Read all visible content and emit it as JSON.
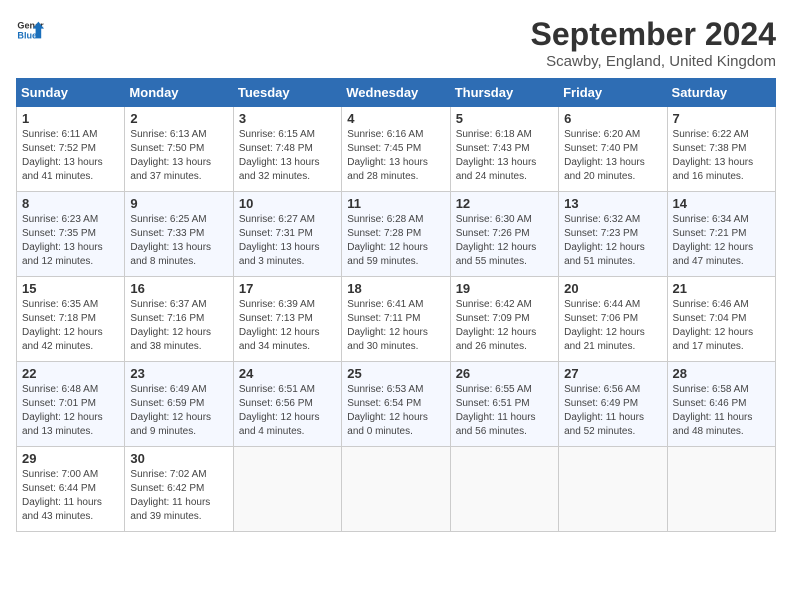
{
  "header": {
    "logo_line1": "General",
    "logo_line2": "Blue",
    "month": "September 2024",
    "location": "Scawby, England, United Kingdom"
  },
  "weekdays": [
    "Sunday",
    "Monday",
    "Tuesday",
    "Wednesday",
    "Thursday",
    "Friday",
    "Saturday"
  ],
  "weeks": [
    [
      {
        "day": "1",
        "sunrise": "6:11 AM",
        "sunset": "7:52 PM",
        "daylight": "13 hours and 41 minutes."
      },
      {
        "day": "2",
        "sunrise": "6:13 AM",
        "sunset": "7:50 PM",
        "daylight": "13 hours and 37 minutes."
      },
      {
        "day": "3",
        "sunrise": "6:15 AM",
        "sunset": "7:48 PM",
        "daylight": "13 hours and 32 minutes."
      },
      {
        "day": "4",
        "sunrise": "6:16 AM",
        "sunset": "7:45 PM",
        "daylight": "13 hours and 28 minutes."
      },
      {
        "day": "5",
        "sunrise": "6:18 AM",
        "sunset": "7:43 PM",
        "daylight": "13 hours and 24 minutes."
      },
      {
        "day": "6",
        "sunrise": "6:20 AM",
        "sunset": "7:40 PM",
        "daylight": "13 hours and 20 minutes."
      },
      {
        "day": "7",
        "sunrise": "6:22 AM",
        "sunset": "7:38 PM",
        "daylight": "13 hours and 16 minutes."
      }
    ],
    [
      {
        "day": "8",
        "sunrise": "6:23 AM",
        "sunset": "7:35 PM",
        "daylight": "13 hours and 12 minutes."
      },
      {
        "day": "9",
        "sunrise": "6:25 AM",
        "sunset": "7:33 PM",
        "daylight": "13 hours and 8 minutes."
      },
      {
        "day": "10",
        "sunrise": "6:27 AM",
        "sunset": "7:31 PM",
        "daylight": "13 hours and 3 minutes."
      },
      {
        "day": "11",
        "sunrise": "6:28 AM",
        "sunset": "7:28 PM",
        "daylight": "12 hours and 59 minutes."
      },
      {
        "day": "12",
        "sunrise": "6:30 AM",
        "sunset": "7:26 PM",
        "daylight": "12 hours and 55 minutes."
      },
      {
        "day": "13",
        "sunrise": "6:32 AM",
        "sunset": "7:23 PM",
        "daylight": "12 hours and 51 minutes."
      },
      {
        "day": "14",
        "sunrise": "6:34 AM",
        "sunset": "7:21 PM",
        "daylight": "12 hours and 47 minutes."
      }
    ],
    [
      {
        "day": "15",
        "sunrise": "6:35 AM",
        "sunset": "7:18 PM",
        "daylight": "12 hours and 42 minutes."
      },
      {
        "day": "16",
        "sunrise": "6:37 AM",
        "sunset": "7:16 PM",
        "daylight": "12 hours and 38 minutes."
      },
      {
        "day": "17",
        "sunrise": "6:39 AM",
        "sunset": "7:13 PM",
        "daylight": "12 hours and 34 minutes."
      },
      {
        "day": "18",
        "sunrise": "6:41 AM",
        "sunset": "7:11 PM",
        "daylight": "12 hours and 30 minutes."
      },
      {
        "day": "19",
        "sunrise": "6:42 AM",
        "sunset": "7:09 PM",
        "daylight": "12 hours and 26 minutes."
      },
      {
        "day": "20",
        "sunrise": "6:44 AM",
        "sunset": "7:06 PM",
        "daylight": "12 hours and 21 minutes."
      },
      {
        "day": "21",
        "sunrise": "6:46 AM",
        "sunset": "7:04 PM",
        "daylight": "12 hours and 17 minutes."
      }
    ],
    [
      {
        "day": "22",
        "sunrise": "6:48 AM",
        "sunset": "7:01 PM",
        "daylight": "12 hours and 13 minutes."
      },
      {
        "day": "23",
        "sunrise": "6:49 AM",
        "sunset": "6:59 PM",
        "daylight": "12 hours and 9 minutes."
      },
      {
        "day": "24",
        "sunrise": "6:51 AM",
        "sunset": "6:56 PM",
        "daylight": "12 hours and 4 minutes."
      },
      {
        "day": "25",
        "sunrise": "6:53 AM",
        "sunset": "6:54 PM",
        "daylight": "12 hours and 0 minutes."
      },
      {
        "day": "26",
        "sunrise": "6:55 AM",
        "sunset": "6:51 PM",
        "daylight": "11 hours and 56 minutes."
      },
      {
        "day": "27",
        "sunrise": "6:56 AM",
        "sunset": "6:49 PM",
        "daylight": "11 hours and 52 minutes."
      },
      {
        "day": "28",
        "sunrise": "6:58 AM",
        "sunset": "6:46 PM",
        "daylight": "11 hours and 48 minutes."
      }
    ],
    [
      {
        "day": "29",
        "sunrise": "7:00 AM",
        "sunset": "6:44 PM",
        "daylight": "11 hours and 43 minutes."
      },
      {
        "day": "30",
        "sunrise": "7:02 AM",
        "sunset": "6:42 PM",
        "daylight": "11 hours and 39 minutes."
      },
      null,
      null,
      null,
      null,
      null
    ]
  ]
}
